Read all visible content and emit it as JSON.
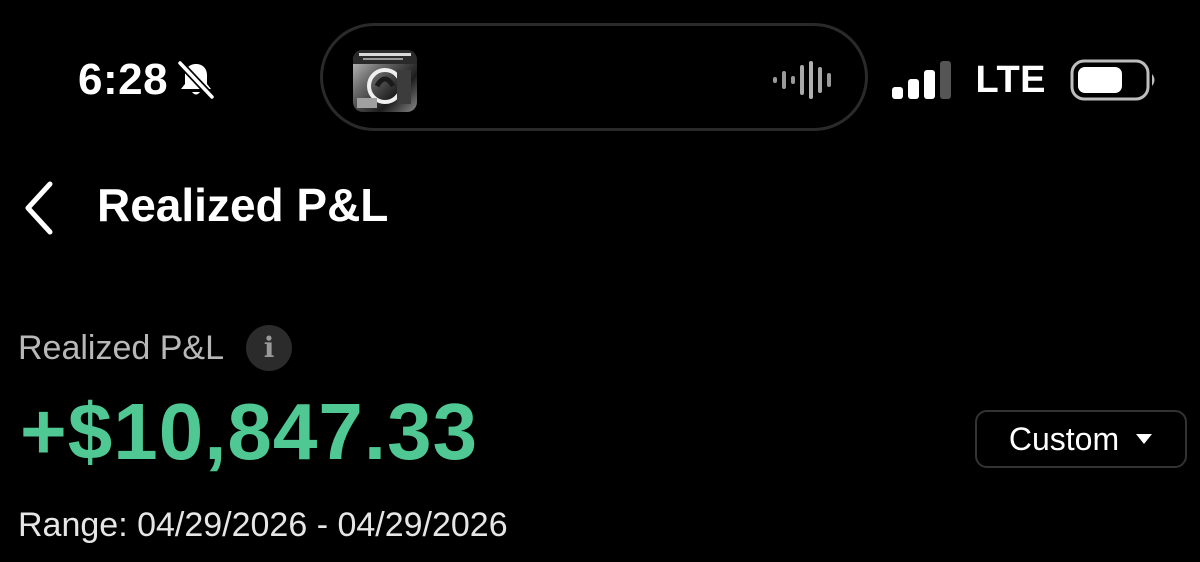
{
  "status_bar": {
    "time": "6:28",
    "network": "LTE",
    "signal_bars": 3,
    "signal_bars_total": 4,
    "icons": [
      "bell-slash-icon",
      "waveform-icon",
      "signal-icon",
      "battery-icon"
    ]
  },
  "dynamic_island": {
    "content": "now-playing",
    "icons": [
      "album-art",
      "waveform-icon"
    ]
  },
  "nav": {
    "back_icon": "chevron-left-icon",
    "title": "Realized P&L"
  },
  "summary": {
    "label": "Realized P&L",
    "info_icon": "info-icon",
    "info_glyph": "i",
    "amount": "+$10,847.33",
    "period_label": "Custom",
    "period_caret_icon": "caret-down-icon",
    "range_text": "Range: 04/29/2026 - 04/29/2026"
  },
  "colors": {
    "background": "#000000",
    "positive": "#4fc894",
    "label_gray": "#b8b8b8",
    "button_border": "#333333"
  }
}
